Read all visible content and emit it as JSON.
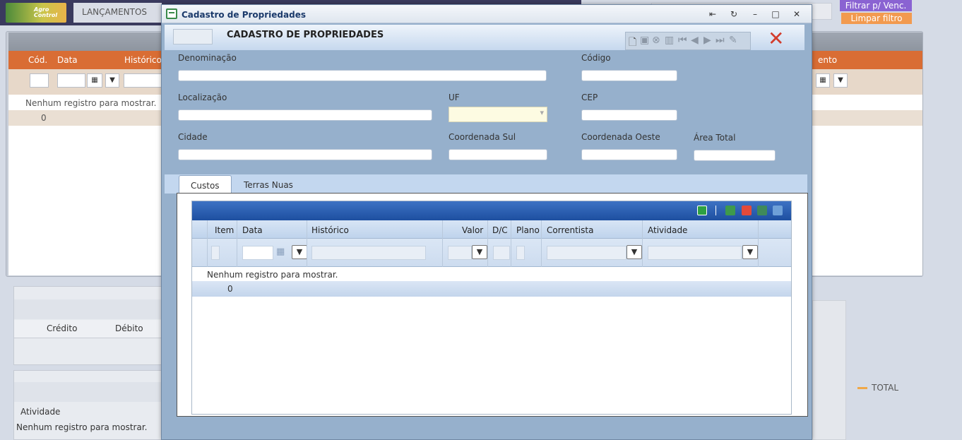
{
  "app": {
    "tab_label": "LANÇAMENTOS",
    "logo_text": "Agro Control",
    "filter_due_button": "Filtrar p/ Venc.",
    "clear_filter_button": "Limpar filtro",
    "bg_columns": [
      "Cód.",
      "Data",
      "Histórico"
    ],
    "bg_right_column_fragment": "ento",
    "bg_empty_message": "Nenhum registro para mostrar.",
    "bg_count": "0",
    "bg_sub1_columns": [
      "Crédito",
      "Débito"
    ],
    "bg_sub2_column": "Atividade",
    "bg_sub2_empty": "Nenhum registro para mostrar.",
    "legend_total": "TOTAL"
  },
  "dialog": {
    "window_title": "Cadastro de Propriedades",
    "header_title": "CADASTRO DE PROPRIEDADES",
    "fields": {
      "denominacao": {
        "label": "Denominação",
        "value": ""
      },
      "codigo": {
        "label": "Código",
        "value": ""
      },
      "localizacao": {
        "label": "Localização",
        "value": ""
      },
      "uf": {
        "label": "UF",
        "value": ""
      },
      "cep": {
        "label": "CEP",
        "value": ""
      },
      "cidade": {
        "label": "Cidade",
        "value": ""
      },
      "coord_sul": {
        "label": "Coordenada Sul",
        "value": ""
      },
      "coord_oeste": {
        "label": "Coordenada Oeste",
        "value": ""
      },
      "area_total": {
        "label": "Área Total",
        "value": ""
      }
    },
    "tabs": [
      {
        "label": "Custos",
        "active": true
      },
      {
        "label": "Terras Nuas",
        "active": false
      }
    ],
    "grid": {
      "columns": [
        "Item",
        "Data",
        "Histórico",
        "Valor",
        "D/C",
        "Plano",
        "Correntista",
        "Atividade"
      ],
      "empty_message": "Nenhum registro para mostrar.",
      "count": "0"
    }
  },
  "colors": {
    "dialog_bg": "#96b0cc",
    "grid_toolbar": "#1d4fa0",
    "bg_header": "#d96d34",
    "filter_btn": "#8a63d2",
    "clear_btn": "#f29a4f",
    "close_x": "#d23c2c"
  }
}
